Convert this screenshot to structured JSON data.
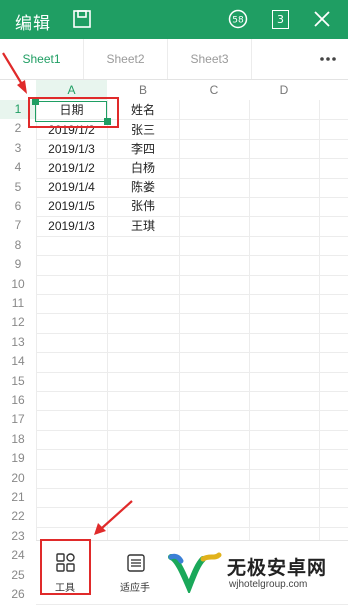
{
  "header": {
    "title": "编辑",
    "tabs_count": "3",
    "badge_label": "58",
    "colors": {
      "bar": "#1f9e63",
      "accent": "#1f9e63"
    }
  },
  "sheets": [
    {
      "label": "Sheet1",
      "active": true
    },
    {
      "label": "Sheet2",
      "active": false
    },
    {
      "label": "Sheet3",
      "active": false
    }
  ],
  "more_label": "•••",
  "columns": [
    "A",
    "B",
    "C",
    "D"
  ],
  "rows": [
    "1",
    "2",
    "3",
    "4",
    "5",
    "6",
    "7",
    "8",
    "9",
    "10",
    "11",
    "12",
    "13",
    "14",
    "15",
    "16",
    "17",
    "18",
    "19",
    "20",
    "21",
    "22",
    "23",
    "24",
    "25",
    "26"
  ],
  "cells": {
    "A1": "日期",
    "B1": "姓名",
    "A2": "2019/1/2",
    "B2": "张三",
    "A3": "2019/1/3",
    "B3": "李四",
    "A4": "2019/1/2",
    "B4": "白杨",
    "A5": "2019/1/4",
    "B5": "陈娄",
    "A6": "2019/1/5",
    "B6": "张伟",
    "A7": "2019/1/3",
    "B7": "王琪"
  },
  "toolbar": {
    "tools_label": "工具",
    "fit_label": "适应手"
  },
  "watermark": {
    "title": "无极安卓网",
    "url": "wjhotelgroup.com"
  }
}
